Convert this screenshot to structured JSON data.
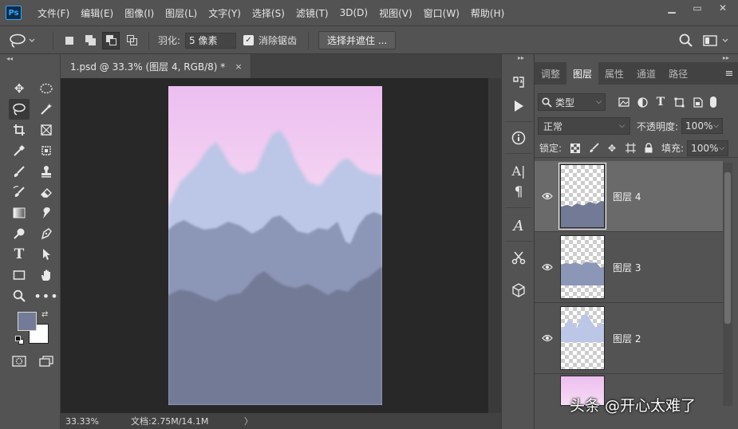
{
  "app": {
    "logo": "Ps"
  },
  "menu": [
    "文件(F)",
    "编辑(E)",
    "图像(I)",
    "图层(L)",
    "文字(Y)",
    "选择(S)",
    "滤镜(T)",
    "3D(D)",
    "视图(V)",
    "窗口(W)",
    "帮助(H)"
  ],
  "window_controls": {
    "minimize": "▁",
    "maximize": "▭",
    "close": "✕"
  },
  "options": {
    "feather_label": "羽化:",
    "feather_value": "5 像素",
    "antialias_label": "消除锯齿",
    "antialias_checked": true,
    "select_mask_button": "选择并遮住 ..."
  },
  "document": {
    "tab_title": "1.psd @ 33.3% (图层 4, RGB/8) *",
    "tab_close": "×",
    "zoom": "33.33%",
    "doc_info": "文档:2.75M/14.1M",
    "arrow": "〉"
  },
  "colors": {
    "foreground": "#737b98",
    "background": "#ffffff",
    "sky_top": "#ecbef0",
    "sky_bottom": "#f7dcf3",
    "mountain_far": "#bcc6e6",
    "mountain_mid": "#8c96b7",
    "mountain_near": "#737a96"
  },
  "layers_panel": {
    "tabs": [
      "调整",
      "图层",
      "属性",
      "通道",
      "路径"
    ],
    "active_tab": "图层",
    "filter_label": "类型",
    "blend_mode": "正常",
    "opacity_label": "不透明度:",
    "opacity_value": "100%",
    "lock_label": "锁定:",
    "fill_label": "填充:",
    "fill_value": "100%",
    "layers": [
      {
        "name": "图层 4",
        "selected": true
      },
      {
        "name": "图层 3",
        "selected": false
      },
      {
        "name": "图层 2",
        "selected": false
      }
    ]
  },
  "watermark": "头条 @开心太难了"
}
